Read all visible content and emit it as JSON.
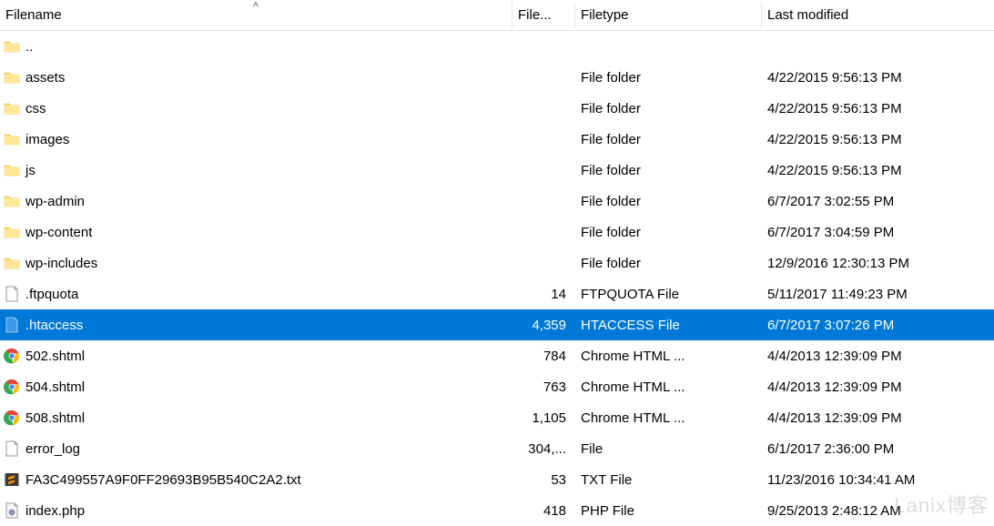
{
  "columns": {
    "filename": "Filename",
    "filesize": "File...",
    "filetype": "Filetype",
    "modified": "Last modified"
  },
  "sort_indicator": "˄",
  "rows": [
    {
      "icon": "folder",
      "name": "..",
      "size": "",
      "type": "",
      "modified": "",
      "selected": false
    },
    {
      "icon": "folder",
      "name": "assets",
      "size": "",
      "type": "File folder",
      "modified": "4/22/2015 9:56:13 PM",
      "selected": false
    },
    {
      "icon": "folder",
      "name": "css",
      "size": "",
      "type": "File folder",
      "modified": "4/22/2015 9:56:13 PM",
      "selected": false
    },
    {
      "icon": "folder",
      "name": "images",
      "size": "",
      "type": "File folder",
      "modified": "4/22/2015 9:56:13 PM",
      "selected": false
    },
    {
      "icon": "folder",
      "name": "js",
      "size": "",
      "type": "File folder",
      "modified": "4/22/2015 9:56:13 PM",
      "selected": false
    },
    {
      "icon": "folder",
      "name": "wp-admin",
      "size": "",
      "type": "File folder",
      "modified": "6/7/2017 3:02:55 PM",
      "selected": false
    },
    {
      "icon": "folder",
      "name": "wp-content",
      "size": "",
      "type": "File folder",
      "modified": "6/7/2017 3:04:59 PM",
      "selected": false
    },
    {
      "icon": "folder",
      "name": "wp-includes",
      "size": "",
      "type": "File folder",
      "modified": "12/9/2016 12:30:13 PM",
      "selected": false
    },
    {
      "icon": "file",
      "name": ".ftpquota",
      "size": "14",
      "type": "FTPQUOTA File",
      "modified": "5/11/2017 11:49:23 PM",
      "selected": false
    },
    {
      "icon": "file-blue",
      "name": ".htaccess",
      "size": "4,359",
      "type": "HTACCESS File",
      "modified": "6/7/2017 3:07:26 PM",
      "selected": true
    },
    {
      "icon": "chrome",
      "name": "502.shtml",
      "size": "784",
      "type": "Chrome HTML ...",
      "modified": "4/4/2013 12:39:09 PM",
      "selected": false
    },
    {
      "icon": "chrome",
      "name": "504.shtml",
      "size": "763",
      "type": "Chrome HTML ...",
      "modified": "4/4/2013 12:39:09 PM",
      "selected": false
    },
    {
      "icon": "chrome",
      "name": "508.shtml",
      "size": "1,105",
      "type": "Chrome HTML ...",
      "modified": "4/4/2013 12:39:09 PM",
      "selected": false
    },
    {
      "icon": "file",
      "name": "error_log",
      "size": "304,...",
      "type": "File",
      "modified": "6/1/2017 2:36:00 PM",
      "selected": false
    },
    {
      "icon": "sublime",
      "name": "FA3C499557A9F0FF29693B95B540C2A2.txt",
      "size": "53",
      "type": "TXT File",
      "modified": "11/23/2016 10:34:41 AM",
      "selected": false
    },
    {
      "icon": "php",
      "name": "index.php",
      "size": "418",
      "type": "PHP File",
      "modified": "9/25/2013 2:48:12 AM",
      "selected": false
    }
  ],
  "watermark": "Lanix博客"
}
